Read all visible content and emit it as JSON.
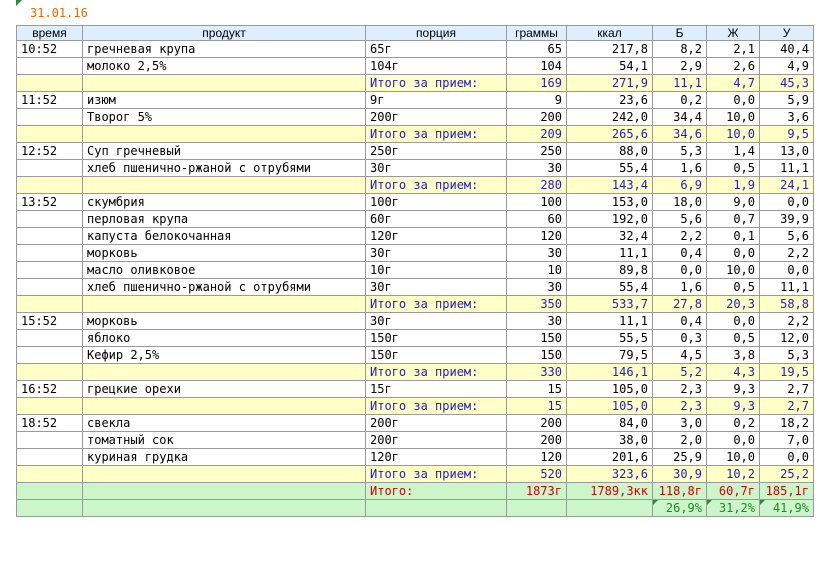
{
  "date": "31.01.16",
  "headers": [
    "время",
    "продукт",
    "порция",
    "граммы",
    "ккал",
    "Б",
    "Ж",
    "У"
  ],
  "meals": [
    {
      "time": "10:52",
      "items": [
        {
          "product": "гречневая крупа",
          "portion": "65г",
          "grams": "65",
          "kcal": "217,8",
          "b": "8,2",
          "zh": "2,1",
          "u": "40,4"
        },
        {
          "product": "молоко 2,5%",
          "portion": "104г",
          "grams": "104",
          "kcal": "54,1",
          "b": "2,9",
          "zh": "2,6",
          "u": "4,9"
        }
      ],
      "subtotal": {
        "label": "Итого за прием:",
        "grams": "169",
        "kcal": "271,9",
        "b": "11,1",
        "zh": "4,7",
        "u": "45,3"
      }
    },
    {
      "time": "11:52",
      "items": [
        {
          "product": "изюм",
          "portion": "9г",
          "grams": "9",
          "kcal": "23,6",
          "b": "0,2",
          "zh": "0,0",
          "u": "5,9"
        },
        {
          "product": "Творог 5%",
          "portion": "200г",
          "grams": "200",
          "kcal": "242,0",
          "b": "34,4",
          "zh": "10,0",
          "u": "3,6"
        }
      ],
      "subtotal": {
        "label": "Итого за прием:",
        "grams": "209",
        "kcal": "265,6",
        "b": "34,6",
        "zh": "10,0",
        "u": "9,5"
      }
    },
    {
      "time": "12:52",
      "items": [
        {
          "product": "Суп гречневый",
          "portion": "250г",
          "grams": "250",
          "kcal": "88,0",
          "b": "5,3",
          "zh": "1,4",
          "u": "13,0"
        },
        {
          "product": "хлеб пшенично-ржаной с отрубями",
          "portion": "30г",
          "grams": "30",
          "kcal": "55,4",
          "b": "1,6",
          "zh": "0,5",
          "u": "11,1"
        }
      ],
      "subtotal": {
        "label": "Итого за прием:",
        "grams": "280",
        "kcal": "143,4",
        "b": "6,9",
        "zh": "1,9",
        "u": "24,1"
      }
    },
    {
      "time": "13:52",
      "items": [
        {
          "product": "скумбрия",
          "portion": "100г",
          "grams": "100",
          "kcal": "153,0",
          "b": "18,0",
          "zh": "9,0",
          "u": "0,0"
        },
        {
          "product": "перловая крупа",
          "portion": "60г",
          "grams": "60",
          "kcal": "192,0",
          "b": "5,6",
          "zh": "0,7",
          "u": "39,9"
        },
        {
          "product": "капуста белокочанная",
          "portion": "120г",
          "grams": "120",
          "kcal": "32,4",
          "b": "2,2",
          "zh": "0,1",
          "u": "5,6"
        },
        {
          "product": "морковь",
          "portion": "30г",
          "grams": "30",
          "kcal": "11,1",
          "b": "0,4",
          "zh": "0,0",
          "u": "2,2"
        },
        {
          "product": "масло оливковое",
          "portion": "10г",
          "grams": "10",
          "kcal": "89,8",
          "b": "0,0",
          "zh": "10,0",
          "u": "0,0"
        },
        {
          "product": "хлеб пшенично-ржаной с отрубями",
          "portion": "30г",
          "grams": "30",
          "kcal": "55,4",
          "b": "1,6",
          "zh": "0,5",
          "u": "11,1"
        }
      ],
      "subtotal": {
        "label": "Итого за прием:",
        "grams": "350",
        "kcal": "533,7",
        "b": "27,8",
        "zh": "20,3",
        "u": "58,8"
      }
    },
    {
      "time": "15:52",
      "items": [
        {
          "product": "морковь",
          "portion": "30г",
          "grams": "30",
          "kcal": "11,1",
          "b": "0,4",
          "zh": "0,0",
          "u": "2,2"
        },
        {
          "product": "яблоко",
          "portion": "150г",
          "grams": "150",
          "kcal": "55,5",
          "b": "0,3",
          "zh": "0,5",
          "u": "12,0"
        },
        {
          "product": "Кефир 2,5%",
          "portion": "150г",
          "grams": "150",
          "kcal": "79,5",
          "b": "4,5",
          "zh": "3,8",
          "u": "5,3"
        }
      ],
      "subtotal": {
        "label": "Итого за прием:",
        "grams": "330",
        "kcal": "146,1",
        "b": "5,2",
        "zh": "4,3",
        "u": "19,5"
      }
    },
    {
      "time": "16:52",
      "items": [
        {
          "product": "грецкие орехи",
          "portion": "15г",
          "grams": "15",
          "kcal": "105,0",
          "b": "2,3",
          "zh": "9,3",
          "u": "2,7"
        }
      ],
      "subtotal": {
        "label": "Итого за прием:",
        "grams": "15",
        "kcal": "105,0",
        "b": "2,3",
        "zh": "9,3",
        "u": "2,7"
      }
    },
    {
      "time": "18:52",
      "items": [
        {
          "product": "свекла",
          "portion": "200г",
          "grams": "200",
          "kcal": "84,0",
          "b": "3,0",
          "zh": "0,2",
          "u": "18,2"
        },
        {
          "product": "томатный сок",
          "portion": "200г",
          "grams": "200",
          "kcal": "38,0",
          "b": "2,0",
          "zh": "0,0",
          "u": "7,0"
        },
        {
          "product": "куриная грудка",
          "portion": "120г",
          "grams": "120",
          "kcal": "201,6",
          "b": "25,9",
          "zh": "10,0",
          "u": "0,0"
        }
      ],
      "subtotal": {
        "label": "Итого за прием:",
        "grams": "520",
        "kcal": "323,6",
        "b": "30,9",
        "zh": "10,2",
        "u": "25,2"
      }
    }
  ],
  "total": {
    "label": "Итого:",
    "grams": "1873г",
    "kcal": "1789,3кк",
    "b": "118,8г",
    "zh": "60,7г",
    "u": "185,1г"
  },
  "percent": {
    "b": "26,9%",
    "zh": "31,2%",
    "u": "41,9%"
  },
  "colors": {
    "header_bg": "#ddeeff",
    "subtotal_bg": "#ffffc8",
    "subtotal_text": "#1f1fbf",
    "total_bg": "#ccf5cc",
    "total_text": "#d60000",
    "percent_text": "#1f8a1f",
    "date_text": "#e06a00"
  }
}
